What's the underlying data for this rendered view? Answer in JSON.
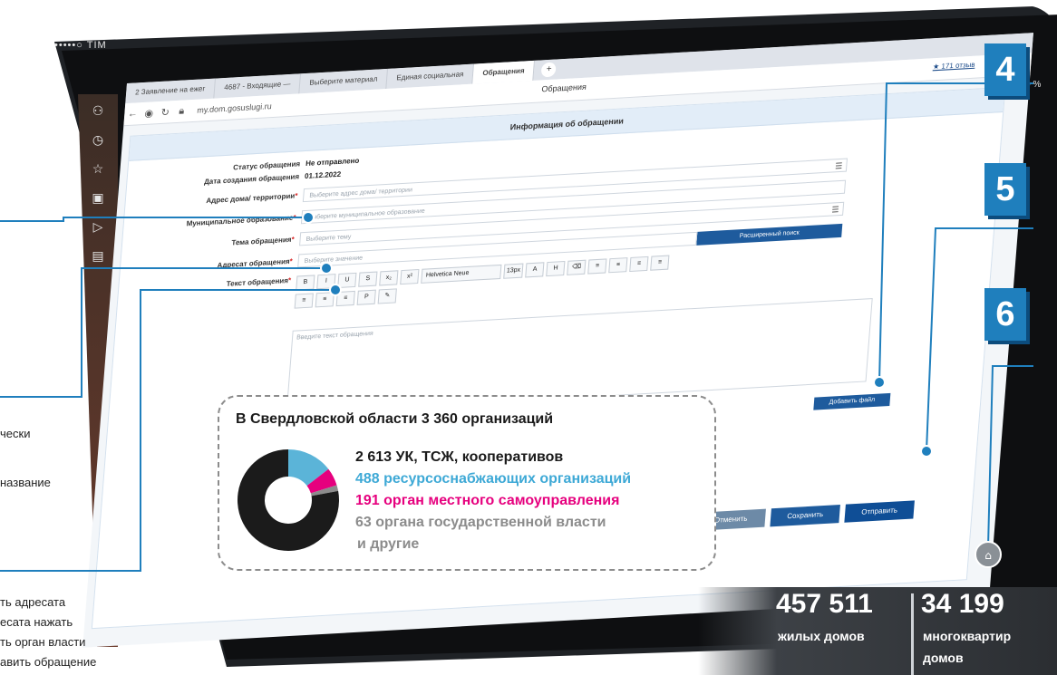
{
  "device": {
    "carrier": "•••••○ TIM",
    "battery": "100 %"
  },
  "browser": {
    "tabs": [
      "2 Заявление на ежег",
      "4687 - Входящие —",
      "Выберите материал",
      "Единая социальная",
      "Обращения"
    ],
    "url": "my.dom.gosuslugi.ru",
    "page_title": "Обращения",
    "rating": "★ 171 отзыв"
  },
  "form": {
    "header": "Информация об обращении",
    "status_label": "Статус обращения",
    "status_value": "Не отправлено",
    "date_label": "Дата создания обращения",
    "date_value": "01.12.2022",
    "address_label": "Адрес дома/ территории",
    "address_placeholder": "Выберите адрес дома/ территории",
    "municipality_label": "Муниципальное образование",
    "municipality_placeholder": "Выберите муниципальное образование",
    "topic_label": "Тема обращения",
    "topic_placeholder": "Выберите тему",
    "addressee_label": "Адресат обращения",
    "addressee_placeholder": "Выберите значение",
    "extended_search": "Расширенный поиск",
    "text_label": "Текст обращения",
    "text_placeholder": "Введите текст обращения",
    "toolbar": {
      "row1": [
        "B",
        "I",
        "U",
        "S",
        "x₂",
        "x²"
      ],
      "font": "Helvetica Neue",
      "size": "13px",
      "row1b": [
        "A",
        "H",
        "⌫",
        "≡",
        "≡",
        "≡",
        "≡"
      ],
      "row2": [
        "≡",
        "≡",
        "≡",
        "P",
        "✎"
      ]
    },
    "attach_button": "Добавить файл",
    "cancel_button": "Отменить",
    "save_button": "Сохранить",
    "send_button": "Отправить"
  },
  "steps": [
    {
      "number": "4"
    },
    {
      "number": "5"
    },
    {
      "number": "6"
    }
  ],
  "left_captions": {
    "c1": "чески",
    "c2": "название",
    "c3": "ть адресата",
    "c4": "есата нажать",
    "c5": "ть орган власти",
    "c6": "авить обращение"
  },
  "info": {
    "title": "В Свердловской области 3 360 организаций",
    "line1": "2 613 УК, ТСЖ, кооперативов",
    "line2": "488 ресурсоснабжающих организаций",
    "line3": "191 орган местного самоуправления",
    "line4a": "63 органа государственной власти",
    "line4b": "и другие"
  },
  "chart_data": {
    "type": "pie",
    "categories": [
      "УК, ТСЖ, кооперативы",
      "ресурсоснабжающие организации",
      "органы местного самоуправления",
      "органы государственной власти и другие"
    ],
    "values": [
      2613,
      488,
      191,
      63
    ],
    "colors": [
      "#1b1b1b",
      "#5bb4d8",
      "#e6007e",
      "#8c8c8c"
    ],
    "title": "В Свердловской области 3 360 организаций"
  },
  "stats": [
    {
      "value": "457 511",
      "label": "жилых домов"
    },
    {
      "value": "34 199",
      "label": "многоквартир",
      "label2": "домов"
    }
  ],
  "colors": {
    "accent_blue": "#1f7fbd",
    "form_blue": "#1e5b9d",
    "magenta": "#e6007e",
    "light_blue": "#5bb4d8"
  }
}
